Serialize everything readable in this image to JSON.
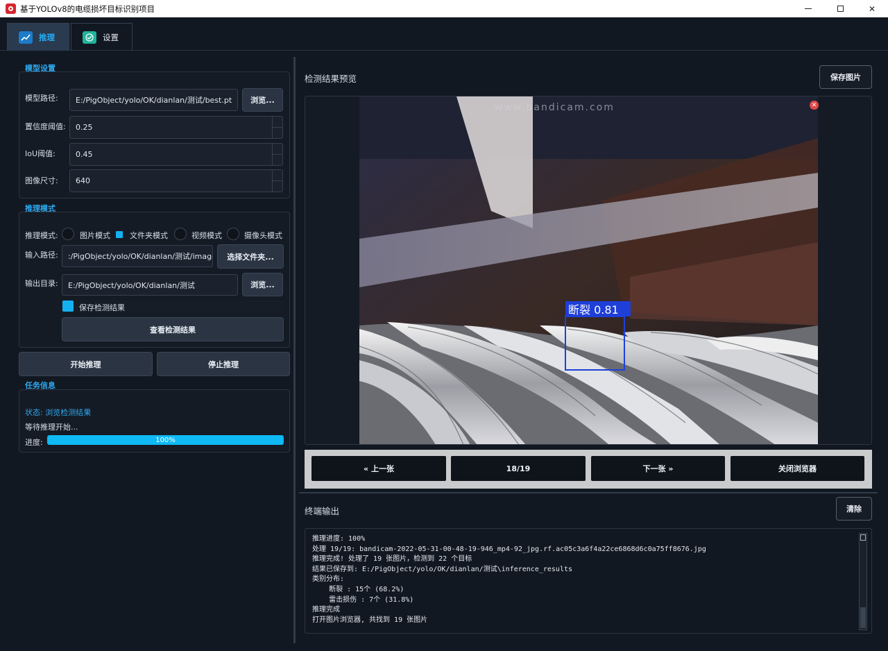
{
  "window": {
    "title": "基于YOLOv8的电缆损坏目标识别项目"
  },
  "tabs": [
    {
      "label": "推理",
      "icon": "chart-icon",
      "active": true
    },
    {
      "label": "设置",
      "icon": "checkmark-icon",
      "active": false
    }
  ],
  "model_settings": {
    "title": "模型设置",
    "model_path_label": "模型路径:",
    "model_path_value": "E:/PigObject/yolo/OK/dianlan/测试/best.pt",
    "browse_label": "浏览...",
    "confidence_label": "置信度阈值:",
    "confidence_value": "0.25",
    "iou_label": "IoU阈值:",
    "iou_value": "0.45",
    "image_size_label": "图像尺寸:",
    "image_size_value": "640"
  },
  "inference_mode": {
    "title": "推理模式",
    "mode_label": "推理模式:",
    "options": [
      "图片模式",
      "文件夹模式",
      "视频模式",
      "摄像头模式"
    ],
    "selected": "文件夹模式",
    "input_path_label": "输入路径:",
    "input_path_value": ":/PigObject/yolo/OK/dianlan/测试/image",
    "select_folder_label": "选择文件夹...",
    "output_dir_label": "输出目录:",
    "output_dir_value": "E:/PigObject/yolo/OK/dianlan/测试",
    "browse_label": "浏览...",
    "save_results_label": "保存检测结果",
    "save_results_checked": true,
    "view_results_label": "查看检测结果"
  },
  "actions": {
    "start_label": "开始推理",
    "stop_label": "停止推理"
  },
  "task_info": {
    "title": "任务信息",
    "status_text": "状态: 浏览检测结果",
    "waiting_text": "等待推理开始...",
    "progress_label": "进度:",
    "progress_value": 100,
    "progress_text": "100%"
  },
  "preview": {
    "title": "检测结果预览",
    "save_image_label": "保存图片",
    "detection_label": "断裂  0.81",
    "watermark_text": "www.bandicam.com",
    "close_icon": "close-icon"
  },
  "navigation": {
    "prev_label": "« 上一张",
    "counter": "18/19",
    "next_label": "下一张 »",
    "close_browser_label": "关闭浏览器"
  },
  "terminal": {
    "title": "终端输出",
    "clear_label": "清除",
    "lines": [
      "推理进度: 100%",
      "处理 19/19: bandicam-2022-05-31-00-48-19-946_mp4-92_jpg.rf.ac05c3a6f4a22ce6868d6c0a75ff8676.jpg",
      "推理完成! 处理了 19 张图片，检测到 22 个目标",
      "结果已保存到: E:/PigObject/yolo/OK/dianlan/测试\\inference_results",
      "类别分布:",
      "    断裂 : 15个 (68.2%)",
      "    雷击损伤 : 7个 (31.8%)",
      "推理完成",
      "打开图片浏览器, 共找到 19 张图片"
    ]
  },
  "colors": {
    "accent": "#13b1f2",
    "background": "#121821",
    "detection_box": "#1e3fd8"
  }
}
